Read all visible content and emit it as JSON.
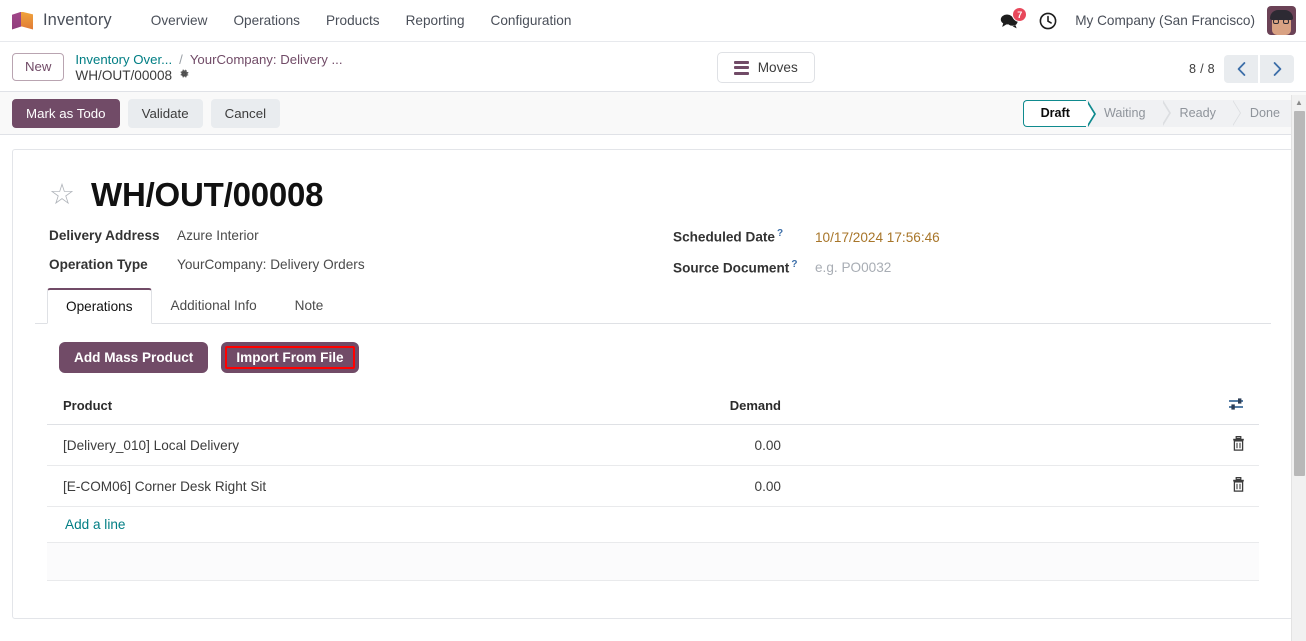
{
  "navbar": {
    "brand": "Inventory",
    "menu": [
      "Overview",
      "Operations",
      "Products",
      "Reporting",
      "Configuration"
    ],
    "messages_icon": "messages-icon",
    "messages_count": "7",
    "activities_icon": "clock-icon",
    "company": "My Company (San Francisco)",
    "avatar_icon": "user-avatar"
  },
  "control_panel": {
    "new_label": "New",
    "breadcrumb": [
      {
        "label": "Inventory Over...",
        "kind": "link"
      },
      {
        "label": "YourCompany: Delivery ...",
        "kind": "link"
      }
    ],
    "separator": "/",
    "record_name": "WH/OUT/00008",
    "gear_icon": "gear-icon",
    "moves_label": "Moves",
    "moves_icon": "list-icon",
    "pager": {
      "text": "8 / 8",
      "prev_icon": "chevron-left-icon",
      "next_icon": "chevron-right-icon"
    }
  },
  "statusbar": {
    "buttons": [
      {
        "label": "Mark as Todo",
        "style": "primary"
      },
      {
        "label": "Validate",
        "style": "secondary"
      },
      {
        "label": "Cancel",
        "style": "secondary"
      }
    ],
    "stages": [
      "Draft",
      "Waiting",
      "Ready",
      "Done"
    ],
    "active_stage": "Draft"
  },
  "record": {
    "star_icon": "star-outline-icon",
    "title": "WH/OUT/00008",
    "fields_left": [
      {
        "label": "Delivery Address",
        "value": "Azure Interior",
        "help": false,
        "state": "normal"
      },
      {
        "label": "Operation Type",
        "value": "YourCompany: Delivery Orders",
        "help": false,
        "state": "normal"
      }
    ],
    "fields_right": [
      {
        "label": "Scheduled Date",
        "value": "10/17/2024 17:56:46",
        "help": true,
        "help_mark": "?",
        "state": "warn"
      },
      {
        "label": "Source Document",
        "value": "e.g. PO0032",
        "help": true,
        "help_mark": "?",
        "state": "placeholder"
      }
    ]
  },
  "notebook": {
    "tabs": [
      "Operations",
      "Additional Info",
      "Note"
    ],
    "active_tab": "Operations"
  },
  "operations": {
    "buttons": [
      {
        "label": "Add Mass Product",
        "highlighted": false
      },
      {
        "label": "Import From File",
        "highlighted": true
      }
    ],
    "columns": [
      "Product",
      "Demand"
    ],
    "optional_columns_icon": "sliders-icon",
    "rows": [
      {
        "product": "[Delivery_010] Local Delivery",
        "demand": "0.00",
        "delete_icon": "trash-icon"
      },
      {
        "product": "[E-COM06] Corner Desk Right Sit",
        "demand": "0.00",
        "delete_icon": "trash-icon"
      }
    ],
    "add_line_label": "Add a line"
  },
  "colors": {
    "primary": "#714b67",
    "link": "#017e84",
    "active_stage_border": "#0f8a8e",
    "warn_text": "#a8762a",
    "badge": "#e8485b",
    "highlight": "#ff0000"
  }
}
